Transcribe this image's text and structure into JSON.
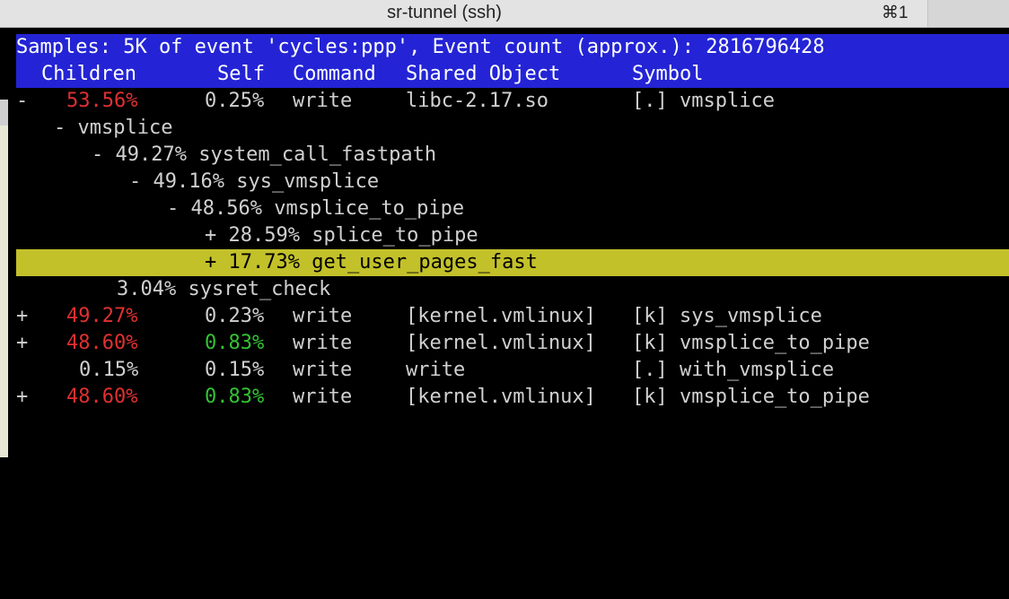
{
  "window": {
    "title": "sr-tunnel (ssh)",
    "shortcut": "⌘1"
  },
  "header": {
    "summary": "Samples: 5K of event 'cycles:ppp', Event count (approx.): 2816796428",
    "columns": [
      "Children",
      "Self",
      "Command",
      "Shared Object",
      "Symbol"
    ]
  },
  "rows": [
    {
      "marker": "-",
      "children": "53.56%",
      "self": "0.25%",
      "command": "write",
      "object": "libc-2.17.so",
      "symbol": "[.] vmsplice"
    },
    {
      "tree": "- vmsplice"
    },
    {
      "tree": "- 49.27% system_call_fastpath"
    },
    {
      "tree": "- 49.16% sys_vmsplice"
    },
    {
      "tree": "- 48.56% vmsplice_to_pipe"
    },
    {
      "tree": "+ 28.59% splice_to_pipe"
    },
    {
      "tree": "+ 17.73% get_user_pages_fast"
    },
    {
      "tree": "3.04% sysret_check"
    },
    {
      "marker": "+",
      "children": "49.27%",
      "self": "0.23%",
      "command": "write",
      "object": "[kernel.vmlinux]",
      "symbol": "[k] sys_vmsplice"
    },
    {
      "marker": "+",
      "children": "48.60%",
      "self": "0.83%",
      "command": "write",
      "object": "[kernel.vmlinux]",
      "symbol": "[k] vmsplice_to_pipe"
    },
    {
      "marker": "",
      "children": "0.15%",
      "self": "0.15%",
      "command": "write",
      "object": "write",
      "symbol": "[.] with_vmsplice"
    },
    {
      "marker": "+",
      "children": "48.60%",
      "self": "0.83%",
      "command": "write",
      "object": "[kernel.vmlinux]",
      "symbol": "[k] vmsplice_to_pipe"
    }
  ],
  "colors": {
    "header_bg": "#2424d6",
    "selection_bg": "#c2c12a",
    "high_percent": "#e03030",
    "medium_percent": "#31c431",
    "normal_text": "#d0d0d0"
  }
}
